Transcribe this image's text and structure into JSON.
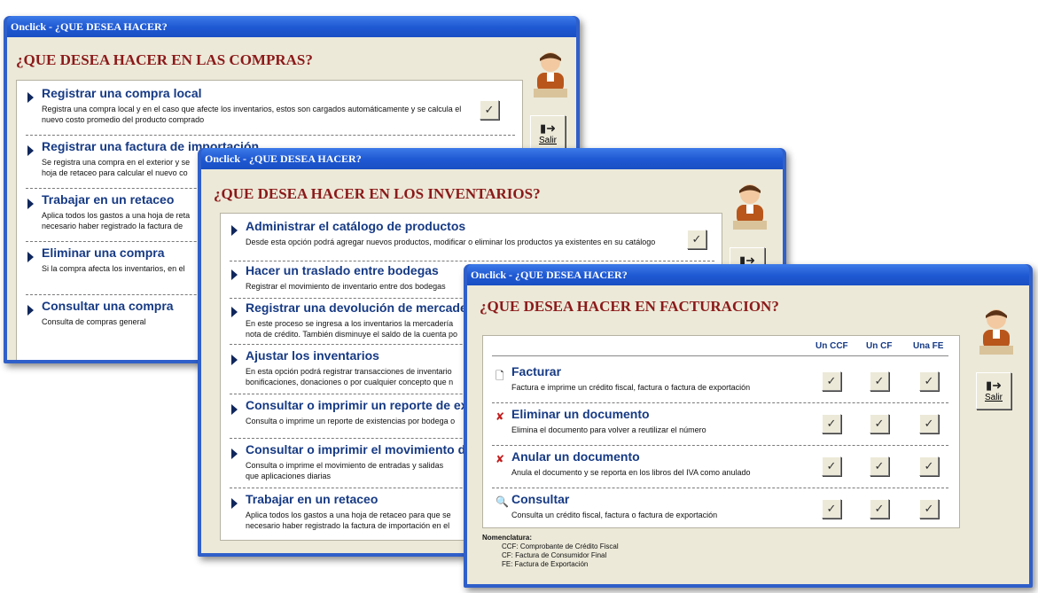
{
  "compras": {
    "title": "Onclick - ¿QUE DESEA HACER?",
    "heading": "¿QUE DESEA HACER EN LAS COMPRAS?",
    "salir": "Salir",
    "items": [
      {
        "title": "Registrar una compra local",
        "desc": "Registra una compra local y en el caso que afecte los inventarios, estos son cargados automáticamente y se calcula el nuevo costo promedio del producto comprado"
      },
      {
        "title": "Registrar una factura de importación",
        "desc": "Se registra una compra en el exterior y se hoja de retaceo para calcular el nuevo co"
      },
      {
        "title": "Trabajar en un retaceo",
        "desc": "Aplica todos los gastos a una hoja de reta necesario haber registrado la factura de"
      },
      {
        "title": "Eliminar una compra",
        "desc": "Si la compra afecta los inventarios, en el"
      },
      {
        "title": "Consultar una compra",
        "desc": "Consulta de compras general"
      }
    ]
  },
  "inventarios": {
    "title": "Onclick - ¿QUE DESEA HACER?",
    "heading": "¿QUE DESEA HACER EN LOS INVENTARIOS?",
    "items": [
      {
        "title": "Administrar el catálogo de productos",
        "desc": "Desde esta opción podrá agregar nuevos productos, modificar o eliminar los productos ya existentes en su catálogo"
      },
      {
        "title": "Hacer un traslado entre bodegas",
        "desc": "Registrar el movimiento de inventario entre dos bodegas"
      },
      {
        "title": "Registrar una devolución de mercade",
        "desc": "En este proceso se ingresa a los inventarios la mercadería nota de crédito. También disminuye el saldo de la cuenta po"
      },
      {
        "title": "Ajustar los inventarios",
        "desc": "En esta opción podrá registrar transacciones de inventario bonificaciones, donaciones o por cualquier concepto que n"
      },
      {
        "title": "Consultar o imprimir un reporte de ex",
        "desc": "Consulta o imprime un reporte de existencias por bodega o"
      },
      {
        "title": "Consultar o imprimir el movimiento d",
        "desc": "Consulta o imprime el movimiento de entradas y salidas que aplicaciones diarias"
      },
      {
        "title": "Trabajar en un retaceo",
        "desc": "Aplica todos los gastos a una hoja de retaceo para que se necesario haber registrado la factura de importación en el"
      }
    ]
  },
  "facturacion": {
    "title": "Onclick - ¿QUE DESEA HACER?",
    "heading": "¿QUE DESEA HACER EN FACTURACION?",
    "salir": "Salir",
    "columns": [
      "Un CCF",
      "Un CF",
      "Una FE"
    ],
    "items": [
      {
        "icon": "page-icon",
        "glyph": "🗋",
        "title": "Facturar",
        "desc": "Factura e imprime un crédito fiscal, factura o factura de exportación"
      },
      {
        "icon": "delete-document-icon",
        "glyph": "✘",
        "title": "Eliminar un documento",
        "desc": "Elimina el documento para volver a reutilizar el número"
      },
      {
        "icon": "cancel-document-icon",
        "glyph": "✘",
        "title": "Anular un documento",
        "desc": "Anula el documento y se reporta en los libros del IVA como anulado"
      },
      {
        "icon": "search-document-icon",
        "glyph": "🔍",
        "title": "Consultar",
        "desc": "Consulta un crédito fiscal, factura o factura de exportación"
      }
    ],
    "nomenclatura": {
      "label": "Nomenclatura:",
      "lines": [
        "CCF: Comprobante de Crédito Fiscal",
        "CF: Factura de Consumidor Final",
        "FE: Factura de Exportación"
      ]
    }
  },
  "icons": {
    "check": "✓",
    "door": "▮➜"
  },
  "colors": {
    "titlebar": "#1e58d2",
    "heading": "#8b1a1a",
    "link": "#163a84",
    "client": "#ece9d8"
  }
}
